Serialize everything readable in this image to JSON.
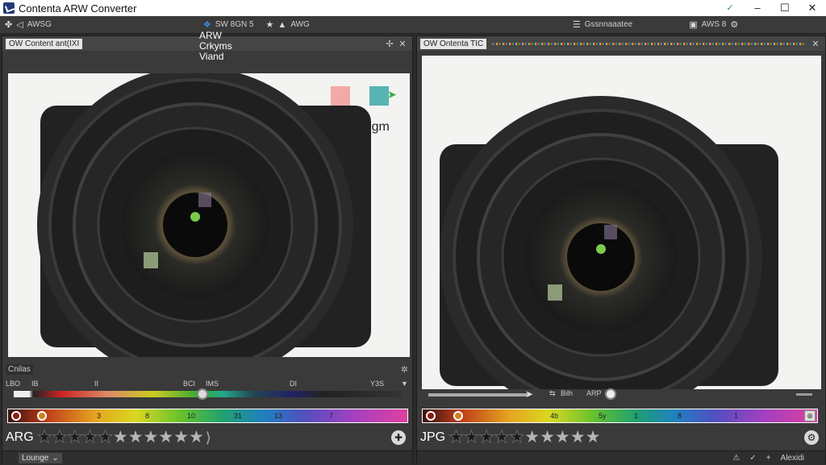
{
  "window": {
    "title": "Contenta ARW Converter"
  },
  "toolbar": {
    "left_label": "AWSG",
    "center_label": "SW  8GN 5",
    "center_label2": "AWG",
    "right_label": "Gssnnaaatee",
    "far_right_label": "AWS 8"
  },
  "overlay": {
    "line1": "ARW",
    "line2": "Crkyms",
    "line3": "Viand"
  },
  "left_panel": {
    "tab": "OW Content ant(IXI",
    "swatch_label": "Sogm",
    "section": "Cnilas",
    "scale": {
      "start": "LBO",
      "b": "IB",
      "c": "II",
      "d": "BCI",
      "e": "IMS",
      "f": "DI",
      "end": "Y3S"
    },
    "color_bar_numbers": [
      "3",
      "8",
      "10",
      "31",
      "13",
      "7"
    ],
    "format": "ARG",
    "rating": 5,
    "max_rating": 12,
    "dropdown": "Lounge"
  },
  "right_panel": {
    "tab": "OW Ontenta TIC",
    "tools": {
      "a": "Bilh",
      "b": "ARP"
    },
    "color_bar_numbers": [
      "4b",
      "5y",
      "1",
      "8",
      "1"
    ],
    "format": "JPG",
    "rating": 5,
    "max_rating": 12,
    "status": "Alexidi"
  },
  "colors": {
    "background": "#2b2b2b",
    "panel": "#3a3a3a",
    "accent": "#3c8ddc"
  }
}
